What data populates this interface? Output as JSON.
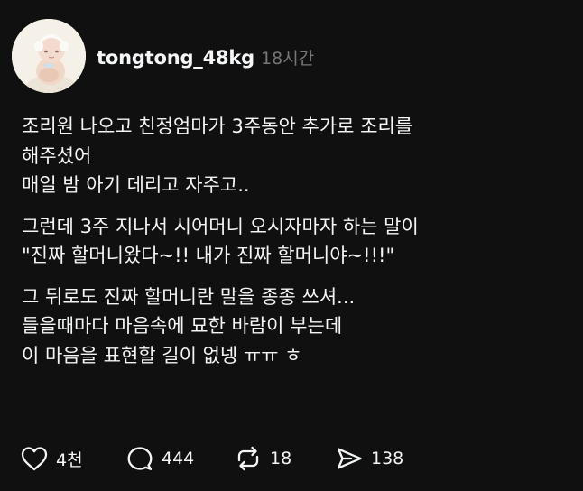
{
  "post": {
    "username": "tongtong_48kg",
    "time": "18시간",
    "paragraphs": [
      [
        "조리원 나오고 친정엄마가 3주동안 추가로 조리를",
        "해주셨어",
        "매일 밤 아기 데리고 자주고.."
      ],
      [
        "그런데 3주 지나서 시어머니 오시자마자 하는 말이",
        "\"진짜 할머니왔다~!! 내가 진짜 할머니야~!!!\""
      ],
      [
        "그 뒤로도 진짜 할머니란 말을 종종 쓰셔...",
        "들을때마다 마음속에 묘한 바람이 부는데",
        "이 마음을 표현할 길이 없넹 ㅠㅠ ㅎ"
      ]
    ],
    "actions": {
      "likes": "4천",
      "replies": "444",
      "reposts": "18",
      "shares": "138"
    }
  },
  "icons": {
    "like": "heart-icon",
    "reply": "speech-bubble-icon",
    "repost": "repost-icon",
    "share": "send-icon"
  },
  "colors": {
    "background": "#101010",
    "text": "#f3f5f7",
    "muted": "#777777"
  }
}
